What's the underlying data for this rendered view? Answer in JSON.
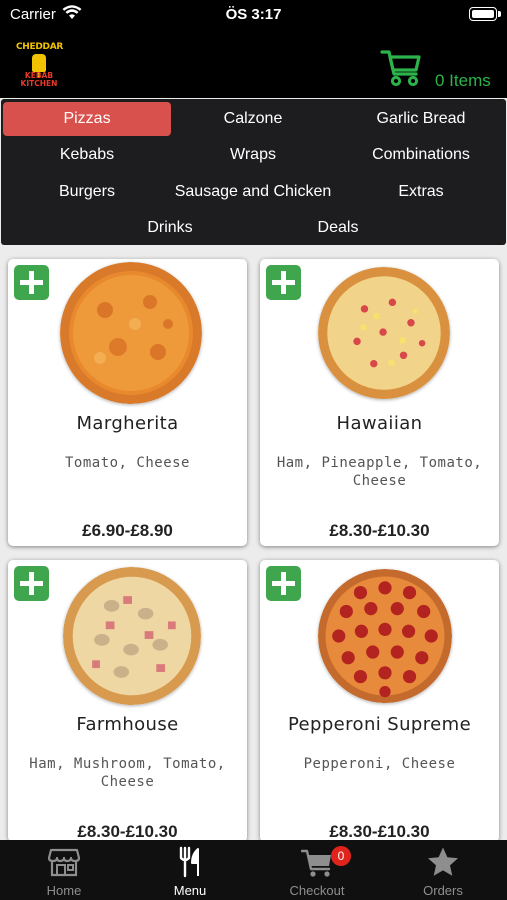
{
  "status_bar": {
    "carrier": "Carrier",
    "time": "ÖS 3:17"
  },
  "header": {
    "logo_top": "CHEDDAR",
    "logo_bottom_line1": "KEBAB",
    "logo_bottom_line2": "KITCHEN",
    "cart_items": "0 Items"
  },
  "categories": [
    {
      "label": "Pizzas",
      "active": true
    },
    {
      "label": "Calzone"
    },
    {
      "label": "Garlic Bread"
    },
    {
      "label": "Kebabs"
    },
    {
      "label": "Wraps"
    },
    {
      "label": "Combinations"
    },
    {
      "label": "Burgers"
    },
    {
      "label": "Sausage and Chicken"
    },
    {
      "label": "Extras"
    },
    {
      "label": "Drinks"
    },
    {
      "label": "Deals"
    }
  ],
  "products": [
    {
      "name": "Margherita",
      "description": "Tomato, Cheese",
      "price": "£6.90-£8.90",
      "image": "margherita-pizza-image"
    },
    {
      "name": "Hawaiian",
      "description": "Ham, Pineapple, Tomato, Cheese",
      "price": "£8.30-£10.30",
      "image": "hawaiian-pizza-image"
    },
    {
      "name": "Farmhouse",
      "description": "Ham, Mushroom, Tomato, Cheese",
      "price": "£8.30-£10.30",
      "image": "farmhouse-pizza-image"
    },
    {
      "name": "Pepperoni Supreme",
      "description": "Pepperoni, Cheese",
      "price": "£8.30-£10.30",
      "image": "pepperoni-pizza-image"
    }
  ],
  "tabbar": [
    {
      "label": "Home",
      "icon": "store-icon"
    },
    {
      "label": "Menu",
      "icon": "fork-knife-icon",
      "active": true
    },
    {
      "label": "Checkout",
      "icon": "cart-icon",
      "badge": "0"
    },
    {
      "label": "Orders",
      "icon": "star-icon"
    }
  ],
  "colors": {
    "accent_red": "#d9514d",
    "cart_green": "#2cb44a",
    "add_button_green": "#3fa64d",
    "badge_red": "#e0241b"
  }
}
